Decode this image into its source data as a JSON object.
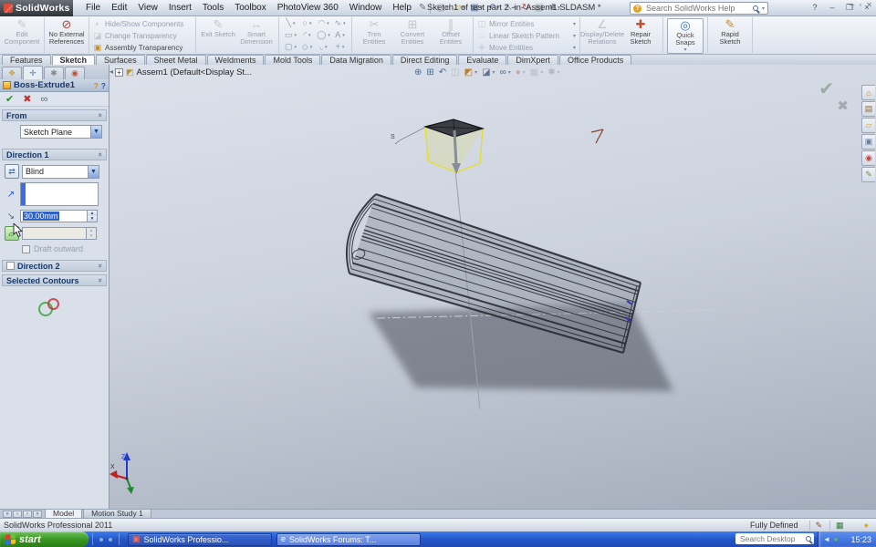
{
  "window": {
    "app": "SolidWorks",
    "title": "Sketch1 of test part 2 -in- Assem1.SLDASM *",
    "search_placeholder": "Search SolidWorks Help",
    "menus": [
      "File",
      "Edit",
      "View",
      "Insert",
      "Tools",
      "Toolbox",
      "PhotoView 360",
      "Window",
      "Help"
    ],
    "quick_icons": [
      {
        "icon": "new-document-icon",
        "caret": true
      },
      {
        "icon": "open-icon",
        "caret": true
      },
      {
        "icon": "save-icon",
        "caret": true
      },
      {
        "icon": "undo-icon",
        "caret": true
      },
      {
        "icon": "select-icon",
        "caret": true
      },
      {
        "icon": "rebuild-icon"
      },
      {
        "icon": "file-properties-icon"
      },
      {
        "icon": "options-icon",
        "caret": true
      }
    ],
    "buttons": {
      "help": "?",
      "minimize": "–",
      "restore": "❐",
      "close": "×"
    }
  },
  "ribbon": {
    "groups": [
      {
        "buttons": [
          {
            "label": "Edit Component",
            "icon": "edit-component-icon",
            "layout": "big",
            "disabled": true
          }
        ]
      },
      {
        "buttons": [
          {
            "label": "No External References",
            "icon": "no-external-references-icon",
            "layout": "big"
          }
        ]
      },
      {
        "buttons": [
          {
            "label": "Hide/Show Components",
            "icon": "hide-show-components-icon",
            "layout": "stack",
            "disabled": true
          },
          {
            "label": "Change Transparency",
            "icon": "change-transparency-icon",
            "layout": "stack",
            "disabled": true
          },
          {
            "label": "Assembly Transparency",
            "icon": "assembly-transparency-icon",
            "layout": "stack"
          }
        ]
      },
      {
        "buttons": [
          {
            "label": "Exit Sketch",
            "icon": "exit-sketch-icon",
            "layout": "big",
            "disabled": true
          },
          {
            "label": "Smart Dimension",
            "icon": "smart-dimension-icon",
            "layout": "big",
            "disabled": true
          }
        ]
      },
      {
        "grid": [
          {
            "icon": "line-icon"
          },
          {
            "icon": "circle-icon"
          },
          {
            "icon": "arc-icon"
          },
          {
            "icon": "spline-icon"
          },
          {
            "icon": "rectangle-icon"
          },
          {
            "icon": "centerpoint-arc-icon"
          },
          {
            "icon": "ellipse-icon"
          },
          {
            "icon": "sketch-text-icon"
          },
          {
            "icon": "slot-icon"
          },
          {
            "icon": "polygon-icon"
          },
          {
            "icon": "sketch-fillet-icon"
          },
          {
            "icon": "point-icon"
          }
        ]
      },
      {
        "buttons": [
          {
            "label": "Trim Entities",
            "icon": "trim-entities-icon",
            "layout": "big",
            "disabled": true
          },
          {
            "label": "Convert Entities",
            "icon": "convert-entities-icon",
            "layout": "big",
            "disabled": true
          },
          {
            "label": "Offset Entities",
            "icon": "offset-entities-icon",
            "layout": "big",
            "disabled": true
          }
        ]
      },
      {
        "buttons": [
          {
            "label": "Mirror Entities",
            "icon": "mirror-entities-icon",
            "layout": "stack",
            "disabled": true,
            "caret": true
          },
          {
            "label": "Linear Sketch Pattern",
            "icon": "linear-pattern-icon",
            "layout": "stack",
            "disabled": true,
            "caret": true
          },
          {
            "label": "Move Entities",
            "icon": "move-entities-icon",
            "layout": "stack",
            "disabled": true,
            "caret": true
          }
        ]
      },
      {
        "buttons": [
          {
            "label": "Display/Delete Relations",
            "icon": "display-delete-relations-icon",
            "layout": "big",
            "disabled": true
          },
          {
            "label": "Repair Sketch",
            "icon": "repair-sketch-icon",
            "layout": "big"
          }
        ]
      },
      {
        "buttons": [
          {
            "label": "Quick Snaps",
            "icon": "quick-snaps-icon",
            "layout": "big",
            "boxed": true,
            "caret": true
          }
        ]
      },
      {
        "buttons": [
          {
            "label": "Rapid Sketch",
            "icon": "rapid-sketch-icon",
            "layout": "big"
          }
        ]
      }
    ]
  },
  "command_tabs": [
    {
      "label": "Features"
    },
    {
      "label": "Sketch",
      "active": true
    },
    {
      "label": "Surfaces"
    },
    {
      "label": "Sheet Metal"
    },
    {
      "label": "Weldments"
    },
    {
      "label": "Mold Tools"
    },
    {
      "label": "Data Migration"
    },
    {
      "label": "Direct Editing"
    },
    {
      "label": "Evaluate"
    },
    {
      "label": "DimXpert"
    },
    {
      "label": "Office Products"
    }
  ],
  "pm": {
    "tabs": [
      {
        "icon": "feature-manager-tab-icon"
      },
      {
        "icon": "property-manager-tab-icon",
        "active": true
      },
      {
        "icon": "configuration-manager-tab-icon"
      },
      {
        "icon": "display-manager-tab-icon"
      }
    ],
    "title": "Boss-Extrude1",
    "header_help": "?",
    "from": {
      "label": "From",
      "value": "Sketch Plane"
    },
    "direction1": {
      "label": "Direction 1",
      "end_condition": "Blind",
      "depth": "30.00mm",
      "draft_outward": "Draft outward"
    },
    "direction2": {
      "label": "Direction 2"
    },
    "selected_contours": {
      "label": "Selected Contours"
    }
  },
  "tree": {
    "root": "Assem1 (Default<Display St..."
  },
  "headsup": [
    {
      "icon": "zoom-fit-icon"
    },
    {
      "icon": "zoom-area-icon"
    },
    {
      "icon": "previous-view-icon"
    },
    {
      "icon": "section-view-icon",
      "disabled": true
    },
    {
      "icon": "view-orientation-icon",
      "caret": true
    },
    {
      "icon": "display-style-icon",
      "caret": true
    },
    {
      "icon": "hide-items-icon",
      "caret": true
    },
    {
      "icon": "edit-appearance-icon",
      "caret": true,
      "disabled": true
    },
    {
      "icon": "apply-scene-icon",
      "caret": true,
      "disabled": true
    },
    {
      "icon": "view-settings-icon",
      "caret": true,
      "disabled": true
    }
  ],
  "taskpane": [
    {
      "icon": "solidworks-resources-icon"
    },
    {
      "icon": "design-library-icon"
    },
    {
      "icon": "file-explorer-icon"
    },
    {
      "icon": "view-palette-icon"
    },
    {
      "icon": "appearances-scenes-icon"
    },
    {
      "icon": "custom-properties-icon"
    }
  ],
  "scene": {
    "sketch_label": "S",
    "axis_x": "X",
    "axis_z": "Z"
  },
  "bottom_tabs": [
    {
      "label": "Model",
      "active": true
    },
    {
      "label": "Motion Study 1"
    }
  ],
  "status": {
    "left": "SolidWorks Professional 2011",
    "state": "Fully Defined"
  },
  "taskbar": {
    "start_label": "start",
    "tasks": [
      {
        "label": "SolidWorks Professio...",
        "icon": "solidworks-task-icon"
      },
      {
        "label": "SolidWorks Forums: T...",
        "icon": "browser-task-icon",
        "active": true
      }
    ],
    "search_placeholder": "Search Desktop",
    "clock": "15:23"
  }
}
